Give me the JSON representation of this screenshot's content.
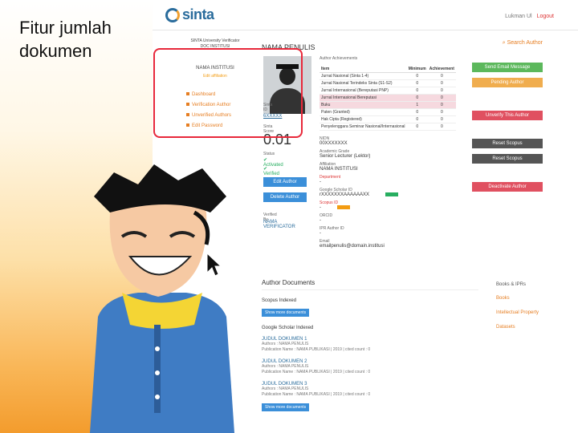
{
  "slide": {
    "title": "Fitur jumlah dokumen"
  },
  "app": {
    "logo": "sinta",
    "logo_sub": "",
    "user_name": "Lukman Ul",
    "user_logout": "Logout"
  },
  "profile": {
    "uni_verificator": "SINTA University Verificator",
    "uni_name": "DOC INSTITUSI",
    "institution": "NAMA INSTITUSI",
    "edit_label": "Edit affiliation",
    "menu": [
      "Dashboard",
      "Verification Author",
      "Unverified Authors",
      "Edit Password"
    ],
    "name_heading": "NAMA PENULIS",
    "sinta_id_label": "Sinta ID",
    "sinta_id_value": "6XXXXX",
    "score_label": "Sinta Score",
    "score_value": "0.01",
    "status_label": "Status",
    "status_1": "Activated",
    "status_2": "Verified",
    "edit_btn": "Edit Author",
    "delete_btn": "Delete Author",
    "verified_by_label": "Verified By",
    "verified_by_value": "NAMA VERIFICATOR"
  },
  "achievements": {
    "heading": "Author Achievements",
    "columns": [
      "Item",
      "Minimum",
      "Achievement"
    ],
    "rows": [
      [
        "Jurnal Nasional (Sinta 1-4)",
        "0",
        "0"
      ],
      [
        "Jurnal Nasional Terindeks Sinta (S1-S2)",
        "0",
        "0"
      ],
      [
        "Jurnal Internasional (Bereputasi PNP)",
        "0",
        "0"
      ],
      [
        "Jurnal Internasional Bereputasi",
        "0",
        "0"
      ],
      [
        "Buku",
        "1",
        "0"
      ],
      [
        "Paten (Granted)",
        "0",
        "0"
      ],
      [
        "Hak Cipta (Registered)",
        "0",
        "0"
      ],
      [
        "Penyelenggara Seminar Nasional/Internasional",
        "0",
        "0"
      ]
    ],
    "highlight_rows": [
      3,
      4
    ]
  },
  "info": {
    "nidn_label": "NIDN",
    "nidn_value": "00XXXXXXX",
    "grade_label": "Academic Grade",
    "grade_value": "Senior Lecturer (Lektor)",
    "affil_label": "Affiliation",
    "affil_value": "NAMA INSTITUSI",
    "dept_label": "Department",
    "dept_value": "-",
    "gs_label": "Google Scholar ID",
    "gs_value": "rXXXXXXXAAAAAAXX",
    "scopus_label": "Scopus ID",
    "scopus_value": "-",
    "orcid_label": "ORCID",
    "orcid_value": "-",
    "ipr_label": "IPR Author ID",
    "ipr_value": "-",
    "email_label": "Email",
    "email_value": "emailpenulis@domain.institusi"
  },
  "actions": {
    "search": "Search Author",
    "send_email": "Send Email Message",
    "pending": "Pending Author",
    "unverify": "Unverify This Author",
    "reset_gs": "Reset Scopus",
    "reset_scopus": "Reset Scopus",
    "deactivate": "Deactivate Author"
  },
  "documents": {
    "heading": "Author Documents",
    "scopus_label": "Scopus Indexed",
    "show_more": "Show more documents",
    "gs_label": "Google Scholar Indexed",
    "items": [
      {
        "title": "JUDUL DOKUMEN 1",
        "authors": "Authors : NAMA PENULIS",
        "pub": "Publication Name : NAMA PUBLIKASI | 2019 | cited count : 0"
      },
      {
        "title": "JUDUL DOKUMEN 2",
        "authors": "Authors : NAMA PENULIS",
        "pub": "Publication Name : NAMA PUBLIKASI | 2019 | cited count : 0"
      },
      {
        "title": "JUDUL DOKUMEN 3",
        "authors": "Authors : NAMA PENULIS",
        "pub": "Publication Name : NAMA PUBLIKASI | 2019 | cited count : 0"
      }
    ],
    "show_more_2": "Show more documents"
  },
  "side": {
    "heading": "Books & IPRs",
    "links": [
      "Books",
      "Intellectual Property",
      "Datasets"
    ]
  }
}
